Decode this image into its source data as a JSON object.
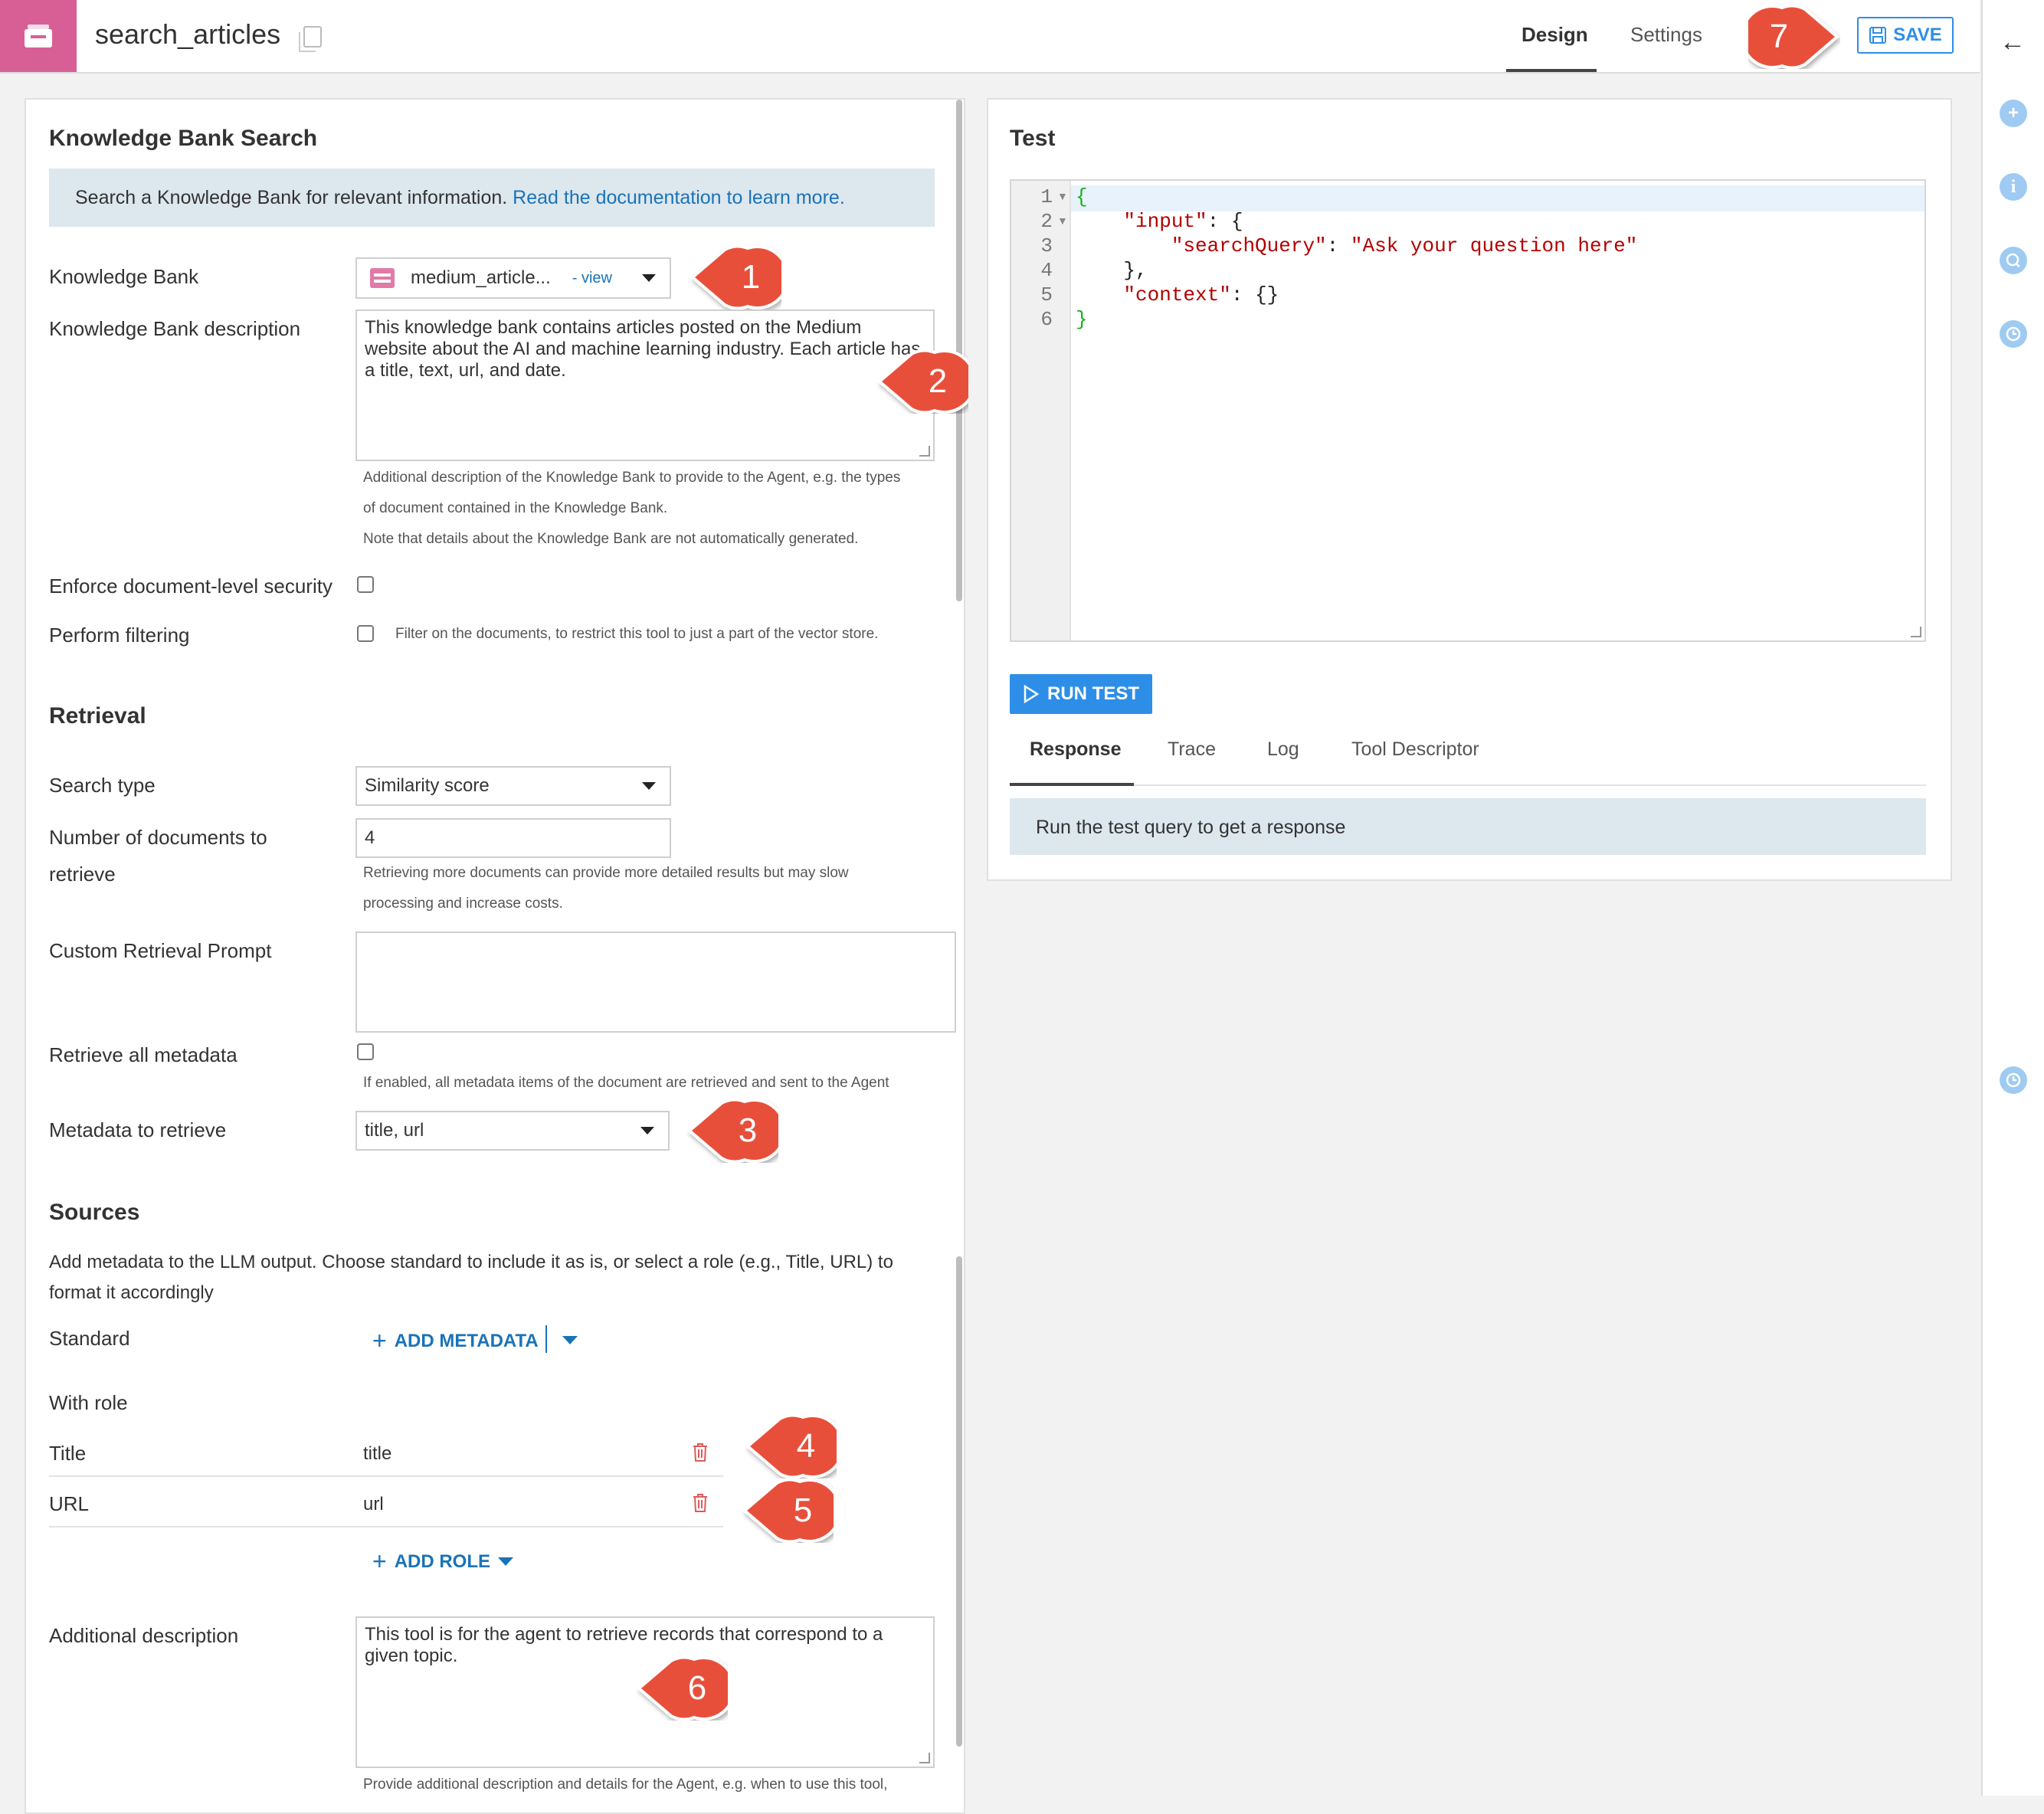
{
  "header": {
    "title": "search_articles",
    "tabs": [
      {
        "label": "Design"
      },
      {
        "label": "Settings"
      }
    ],
    "save_label": "SAVE"
  },
  "left": {
    "section_title": "Knowledge Bank Search",
    "info_text": "Search a Knowledge Bank for relevant information.",
    "info_link": "Read the documentation to learn more.",
    "kb_label": "Knowledge Bank",
    "kb_value": "medium_article...",
    "kb_view_link": "- view",
    "kb_desc_label": "Knowledge Bank description",
    "kb_desc_value": "This knowledge bank contains articles posted on the Medium website about the AI and machine learning industry. Each article has a title, text, url, and date.",
    "kb_desc_help_1": "Additional description of the Knowledge Bank to provide to the Agent, e.g. the types",
    "kb_desc_help_2": "of document contained in the Knowledge Bank.",
    "kb_desc_help_3": "Note that details about the Knowledge Bank are not automatically generated.",
    "security_label": "Enforce document-level security",
    "filtering_label": "Perform filtering",
    "filtering_help": "Filter on the documents, to restrict this tool to just a part of the vector store.",
    "retrieval_title": "Retrieval",
    "search_type_label": "Search type",
    "search_type_value": "Similarity score",
    "num_docs_label_1": "Number of documents to",
    "num_docs_label_2": "retrieve",
    "num_docs_value": "4",
    "num_docs_help_1": "Retrieving more documents can provide more detailed results but may slow",
    "num_docs_help_2": "processing and increase costs.",
    "custom_prompt_label": "Custom Retrieval Prompt",
    "custom_prompt_value": "",
    "retrieve_all_label": "Retrieve all metadata",
    "retrieve_all_help": "If enabled, all metadata items of the document are retrieved and sent to the Agent",
    "metadata_label": "Metadata to retrieve",
    "metadata_value": "title, url",
    "sources_title": "Sources",
    "sources_desc_1": "Add metadata to the LLM output. Choose standard to include it as is, or select a role (e.g., Title, URL) to",
    "sources_desc_2": "format it accordingly",
    "standard_label": "Standard",
    "add_metadata_label": "ADD METADATA",
    "with_role_label": "With role",
    "roles": [
      {
        "role": "Title",
        "value": "title"
      },
      {
        "role": "URL",
        "value": "url"
      }
    ],
    "add_role_label": "ADD ROLE",
    "additional_desc_label": "Additional description",
    "additional_desc_value": "This tool is for the agent to retrieve records that correspond to a given topic.",
    "additional_desc_help": "Provide additional description and details for the Agent, e.g. when to use this tool,"
  },
  "test": {
    "title": "Test",
    "line_numbers": [
      "1",
      "2",
      "3",
      "4",
      "5",
      "6"
    ],
    "code": {
      "l1": "{",
      "l2_key": "\"input\"",
      "l2_rest": ": {",
      "l3_key": "\"searchQuery\"",
      "l3_sep": ": ",
      "l3_val": "\"Ask your question here\"",
      "l4": "},",
      "l5_key": "\"context\"",
      "l5_rest": ": {}",
      "l6": "}"
    },
    "run_label": "RUN TEST",
    "tabs": [
      {
        "label": "Response"
      },
      {
        "label": "Trace"
      },
      {
        "label": "Log"
      },
      {
        "label": "Tool Descriptor"
      }
    ],
    "response_text": "Run the test query to get a response"
  },
  "callouts": [
    "1",
    "2",
    "3",
    "4",
    "5",
    "6",
    "7"
  ],
  "colors": {
    "accent": "#2d8ee8",
    "app_icon": "#d85f96",
    "callout": "#e8503a",
    "delete": "#e05a5a"
  }
}
